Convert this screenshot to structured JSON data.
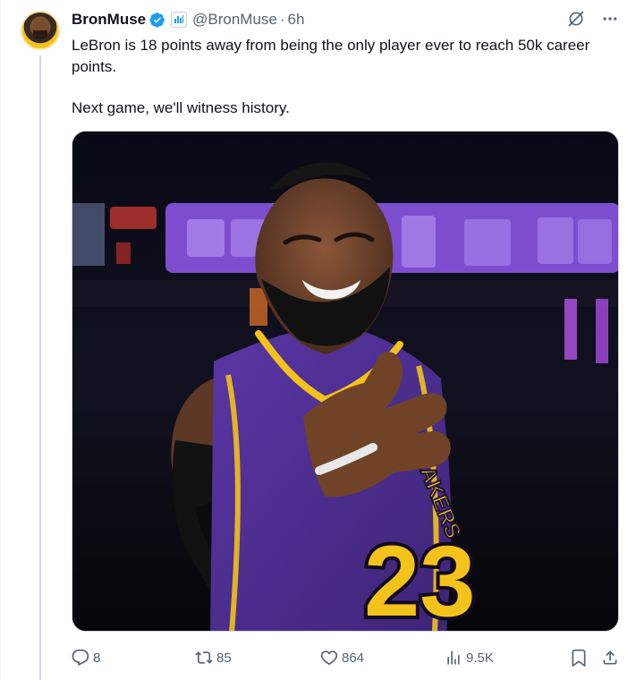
{
  "tweet": {
    "display_name": "BronMuse",
    "handle": "@BronMuse",
    "separator": "·",
    "time": "6h",
    "text_line_1": "LeBron is 18 points away from being the only player ever to reach 50k career points.",
    "text_line_2": "Next game, we'll witness history."
  },
  "media": {
    "jersey_number": "23",
    "team_text": "LAKERS"
  },
  "actions": {
    "reply_count": "8",
    "repost_count": "85",
    "like_count": "864",
    "view_count": "9.5K"
  },
  "icons": {
    "verified": "verified-badge-icon",
    "affiliate": "affiliate-badge-icon",
    "grok": "grok-icon",
    "more": "more-icon",
    "reply": "reply-icon",
    "repost": "repost-icon",
    "like": "heart-icon",
    "views": "views-icon",
    "bookmark": "bookmark-icon",
    "share": "share-icon"
  },
  "colors": {
    "text_primary": "#0f1419",
    "text_secondary": "#536471",
    "verified_blue": "#1d9bf0",
    "divider": "#cfd9de",
    "lakers_purple": "#4b2a8c",
    "lakers_gold": "#f3c21b"
  }
}
